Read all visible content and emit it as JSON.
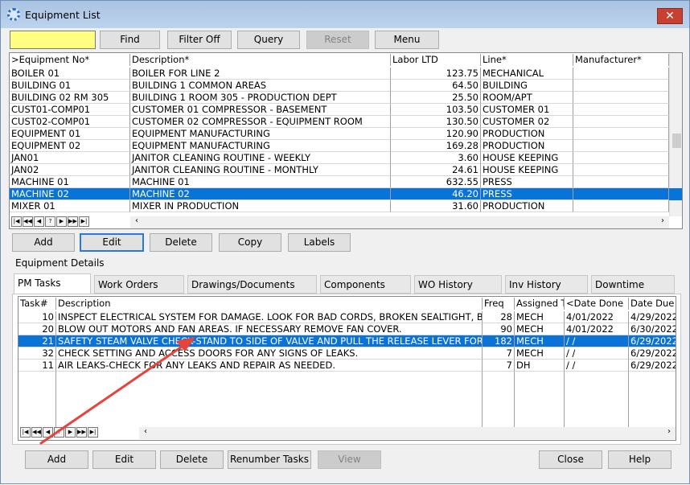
{
  "window": {
    "title": "Equipment List",
    "close": "✕"
  },
  "toolbar": {
    "search_value": "",
    "find": "Find",
    "filter_off": "Filter Off",
    "query": "Query",
    "reset": "Reset",
    "menu": "Menu"
  },
  "equipment_grid": {
    "columns": [
      ">Equipment No*",
      "Description*",
      "Labor LTD",
      "Line*",
      "Manufacturer*"
    ],
    "rows": [
      [
        "BOILER 01",
        "BOILER FOR LINE 2",
        "123.75",
        "MECHANICAL",
        ""
      ],
      [
        "BUILDING 01",
        "BUILDING 1 COMMON AREAS",
        "64.50",
        "BUILDING",
        ""
      ],
      [
        "BUILDING 02 RM 305",
        "BUILDING 1 ROOM 305 - PRODUCTION DEPT",
        "25.50",
        "ROOM/APT",
        ""
      ],
      [
        "CUST01-COMP01",
        "CUSTOMER 01 COMPRESSOR - BASEMENT",
        "103.50",
        "CUSTOMER 01",
        ""
      ],
      [
        "CUST02-COMP01",
        "CUSTOMER 02 COMPRESSOR - EQUIPMENT ROOM",
        "130.50",
        "CUSTOMER 02",
        ""
      ],
      [
        "EQUIPMENT 01",
        "EQUIPMENT MANUFACTURING",
        "120.90",
        "PRODUCTION",
        ""
      ],
      [
        "EQUIPMENT 02",
        "EQUIPMENT MANUFACTURING",
        "169.28",
        "PRODUCTION",
        ""
      ],
      [
        "JAN01",
        "JANITOR CLEANING ROUTINE - WEEKLY",
        "3.60",
        "HOUSE KEEPING",
        ""
      ],
      [
        "JAN02",
        "JANITOR CLEANING ROUTINE - MONTHLY",
        "24.61",
        "HOUSE KEEPING",
        ""
      ],
      [
        "MACHINE 01",
        "MACHINE 01",
        "632.55",
        "PRESS",
        ""
      ],
      [
        "MACHINE 02",
        "MACHINE 02",
        "46.20",
        "PRESS",
        ""
      ],
      [
        "MIXER 01",
        "MIXER IN PRODUCTION",
        "31.60",
        "PRODUCTION",
        ""
      ]
    ],
    "selected_row": 10
  },
  "nav": [
    "|◀",
    "◀◀",
    "◀",
    "?",
    "▶",
    "▶▶",
    "▶|"
  ],
  "equipment_buttons": {
    "add": "Add",
    "edit": "Edit",
    "delete": "Delete",
    "copy": "Copy",
    "labels": "Labels"
  },
  "details": {
    "label": "Equipment Details",
    "tabs": [
      "PM Tasks",
      "Work Orders",
      "Drawings/Documents",
      "Components",
      "WO History",
      "Inv History",
      "Downtime"
    ],
    "active_tab": 0
  },
  "task_grid": {
    "columns": [
      "Task#",
      "Description",
      "Freq",
      "Assigned T",
      "<Date Done",
      "Date Due"
    ],
    "rows": [
      [
        "10",
        "INSPECT ELECTRICAL SYSTEM FOR DAMAGE. LOOK FOR BAD CORDS, BROKEN SEALTIGHT, BOXES FA",
        "28",
        "MECH",
        "4/01/2022",
        "4/29/2022"
      ],
      [
        "20",
        "BLOW OUT MOTORS AND FAN AREAS. IF NECESSARY REMOVE FAN COVER.",
        "90",
        "MECH",
        "4/01/2022",
        "6/30/2022"
      ],
      [
        "21",
        "SAFETY STEAM VALVE CHECK-STAND TO SIDE OF VALVE AND PULL THE RELEASE LEVER FOR THREE",
        "182",
        "MECH",
        "  /  /",
        "6/29/2022"
      ],
      [
        "32",
        "CHECK SETTING AND ACCESS DOORS FOR ANY SIGNS OF LEAKS.",
        "7",
        "MECH",
        "  /  /",
        "6/29/2022"
      ],
      [
        "11",
        "AIR LEAKS-CHECK FOR ANY LEAKS AND REPAIR AS NEEDED.",
        "7",
        "DH",
        "  /  /",
        "6/29/2022"
      ]
    ],
    "selected_row": 2
  },
  "task_buttons": {
    "add": "Add",
    "edit": "Edit",
    "delete": "Delete",
    "renumber": "Renumber Tasks",
    "view": "View",
    "close": "Close",
    "help": "Help"
  },
  "annotation": {
    "arrow_color": "#e8433a"
  }
}
